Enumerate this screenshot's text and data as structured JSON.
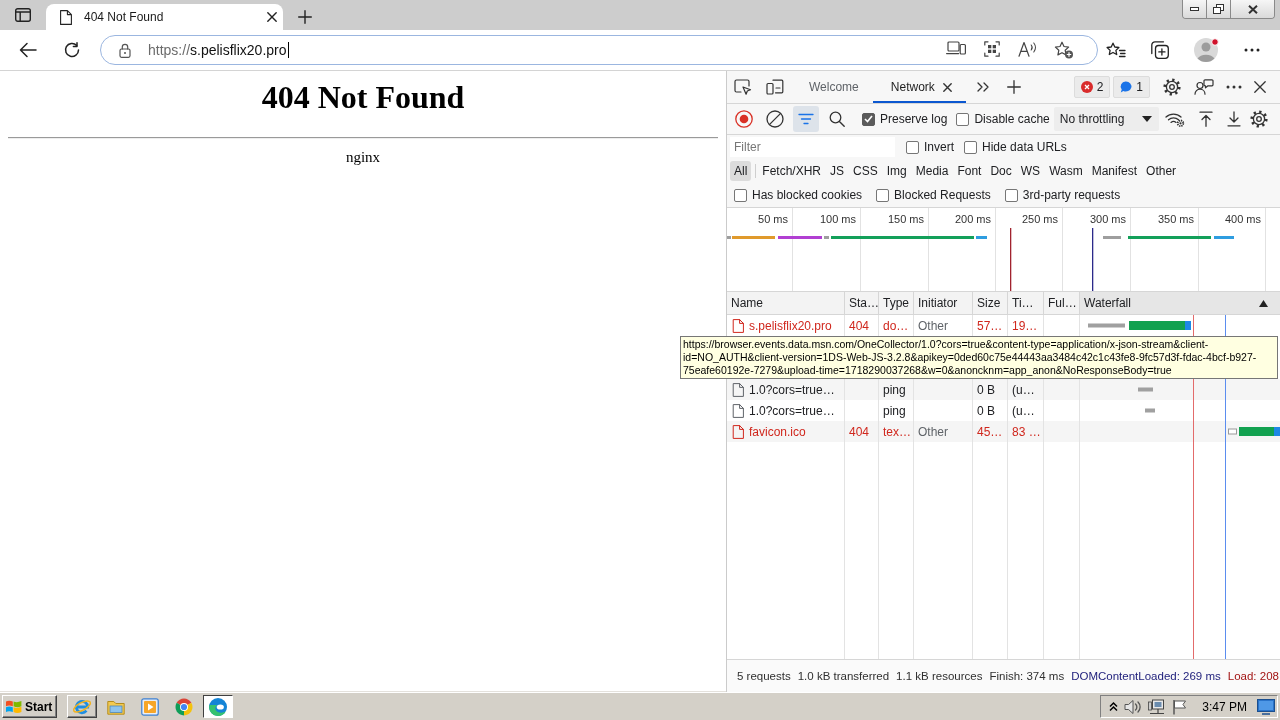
{
  "browser": {
    "tab": {
      "title": "404 Not Found"
    },
    "address": {
      "scheme": "https://",
      "host": "s.pelisflix20.pro"
    }
  },
  "page": {
    "heading": "404 Not Found",
    "footer": "nginx"
  },
  "devtools": {
    "tabs": [
      {
        "label": "Welcome",
        "selected": false,
        "closable": false
      },
      {
        "label": "Network",
        "selected": true,
        "closable": true
      }
    ],
    "counters": [
      {
        "kind": "error",
        "count": "2"
      },
      {
        "kind": "message",
        "count": "1"
      }
    ],
    "toolbar": {
      "recording": true,
      "filter_open": true,
      "preserve_log": {
        "label": "Preserve log",
        "checked": true
      },
      "disable_cache": {
        "label": "Disable cache",
        "checked": false
      },
      "throttling": "No throttling"
    },
    "filter": {
      "placeholder": "Filter",
      "options": [
        {
          "label": "Invert",
          "checked": false
        },
        {
          "label": "Hide data URLs",
          "checked": false
        }
      ]
    },
    "resource_types": [
      {
        "label": "All",
        "selected": true
      },
      {
        "label": "Fetch/XHR",
        "selected": false
      },
      {
        "label": "JS",
        "selected": false
      },
      {
        "label": "CSS",
        "selected": false
      },
      {
        "label": "Img",
        "selected": false
      },
      {
        "label": "Media",
        "selected": false
      },
      {
        "label": "Font",
        "selected": false
      },
      {
        "label": "Doc",
        "selected": false
      },
      {
        "label": "WS",
        "selected": false
      },
      {
        "label": "Wasm",
        "selected": false
      },
      {
        "label": "Manifest",
        "selected": false
      },
      {
        "label": "Other",
        "selected": false
      }
    ],
    "request_filters": [
      {
        "label": "Has blocked cookies",
        "checked": false
      },
      {
        "label": "Blocked Requests",
        "checked": false
      },
      {
        "label": "3rd-party requests",
        "checked": false
      }
    ],
    "overview": {
      "ticks": [
        "50 ms",
        "100 ms",
        "150 ms",
        "200 ms",
        "250 ms",
        "300 ms",
        "350 ms",
        "400 ms"
      ]
    },
    "table": {
      "columns": [
        {
          "label": "Name",
          "sorted": false
        },
        {
          "label": "Sta…",
          "sorted": false
        },
        {
          "label": "Type",
          "sorted": false
        },
        {
          "label": "Initiator",
          "sorted": false
        },
        {
          "label": "Size",
          "sorted": false
        },
        {
          "label": "Ti…",
          "sorted": false
        },
        {
          "label": "Ful…",
          "sorted": false
        },
        {
          "label": "Waterfall",
          "sorted": true
        }
      ],
      "rows": [
        {
          "name": "s.pelisflix20.pro",
          "status": "404",
          "type": "do…",
          "initiator": "Other",
          "size": "57…",
          "time": "19…",
          "failed": true
        },
        {
          "name": "1.0?cors=true…",
          "type": "ping",
          "size": "0 B",
          "time": "(u…",
          "failed": false
        },
        {
          "name": "1.0?cors=true…",
          "type": "ping",
          "size": "0 B",
          "time": "(u…",
          "failed": false
        },
        {
          "name": "favicon.ico",
          "status": "404",
          "type": "tex…",
          "initiator": "Other",
          "size": "45…",
          "time": "83 …",
          "failed": true
        }
      ],
      "tooltip": "https://browser.events.data.msn.com/OneCollector/1.0?cors=true&content-type=application/x-json-stream&client-id=NO_AUTH&client-version=1DS-Web-JS-3.2.8&apikey=0ded60c75e44443aa3484c42c1c43fe8-9fc57d3f-fdac-4bcf-b927-75eafe60192e-7279&upload-time=1718290037268&w=0&anoncknm=app_anon&NoResponseBody=true"
    },
    "summary": [
      {
        "text": "5 requests",
        "kind": "plain"
      },
      {
        "text": "1.0 kB transferred",
        "kind": "plain"
      },
      {
        "text": "1.1 kB resources",
        "kind": "plain"
      },
      {
        "text": "Finish: 374 ms",
        "kind": "plain"
      },
      {
        "text": "DOMContentLoaded: 269 ms",
        "kind": "dom"
      },
      {
        "text": "Load: 208",
        "kind": "load"
      }
    ]
  },
  "taskbar": {
    "start": "Start",
    "apps": [
      {
        "kind": "orbit",
        "raised": true,
        "pressed": false
      },
      {
        "kind": "folder",
        "raised": false,
        "pressed": false
      },
      {
        "kind": "player",
        "raised": false,
        "pressed": false
      },
      {
        "kind": "wheel",
        "raised": false,
        "pressed": false
      },
      {
        "kind": "swirl",
        "raised": false,
        "pressed": true
      }
    ],
    "clock": "3:47 PM"
  }
}
